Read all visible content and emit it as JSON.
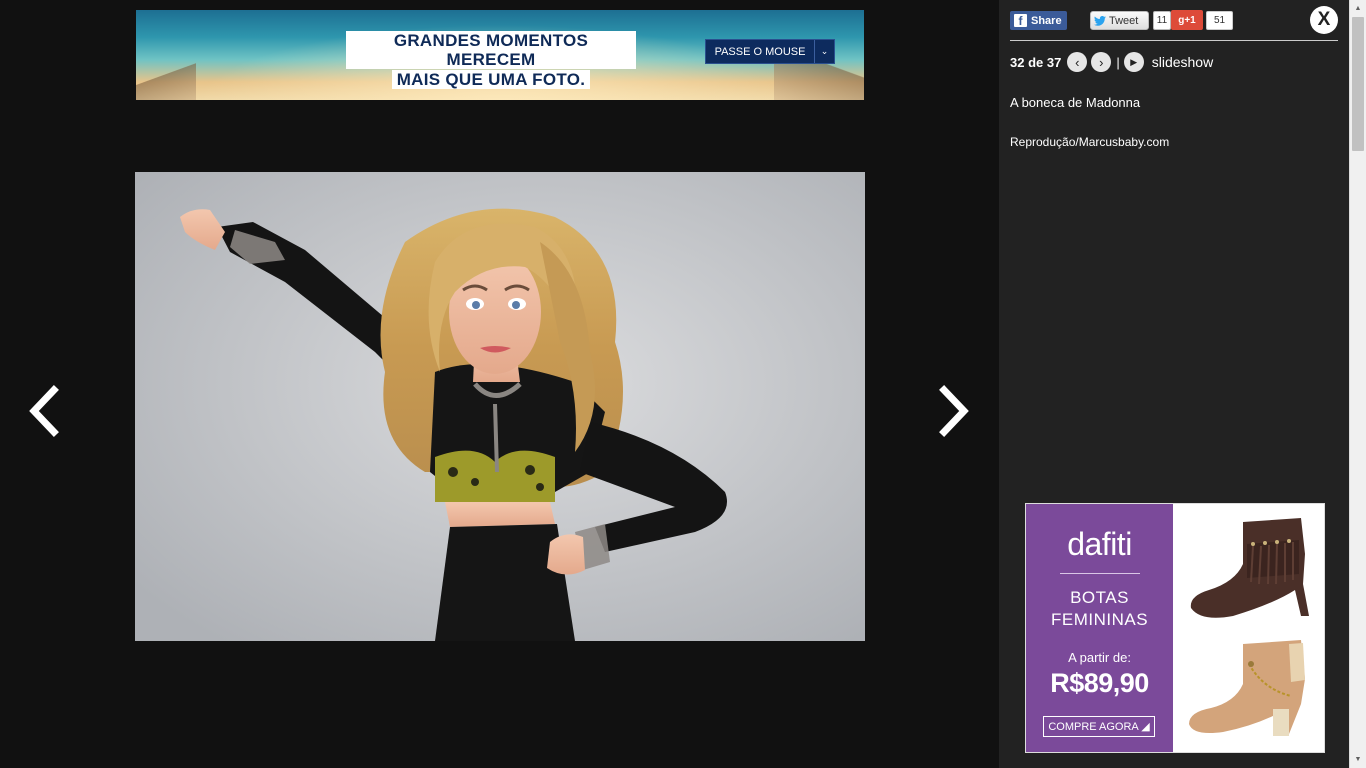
{
  "top_ad": {
    "headline_line1": "GRANDES MOMENTOS MERECEM",
    "headline_line2": "MAIS QUE UMA FOTO.",
    "cta_label": "PASSE O MOUSE",
    "cta_arrow": "⌄"
  },
  "photo": {
    "icon": "doll-photo"
  },
  "navigation": {
    "prev_icon": "chevron-left-icon",
    "next_icon": "chevron-right-icon"
  },
  "social": {
    "facebook_label": "Share",
    "facebook_icon": "f",
    "tweet_label": "Tweet",
    "tweet_count": "11",
    "gplus_label": "g+1",
    "gplus_count": "51"
  },
  "close_label": "X",
  "pager": {
    "count": "32 de 37",
    "prev_glyph": "‹",
    "next_glyph": "›",
    "play_glyph": "▶",
    "separator": "|",
    "slideshow_label": "slideshow"
  },
  "caption": "A boneca de Madonna",
  "credit": "Reprodução/Marcusbaby.com",
  "side_ad": {
    "brand": "dafiti",
    "product_line1": "BOTAS",
    "product_line2": "FEMININAS",
    "from_label": "A partir de:",
    "price": "R$89,90",
    "cta_label": "COMPRE AGORA ◢"
  },
  "colors": {
    "page_bg": "#111111",
    "sidebar_bg": "#222222",
    "facebook": "#3b5b99",
    "gplus": "#dd4b39",
    "dafiti_purple": "#7b4a9a",
    "banner_navy": "#0d2b5e"
  }
}
